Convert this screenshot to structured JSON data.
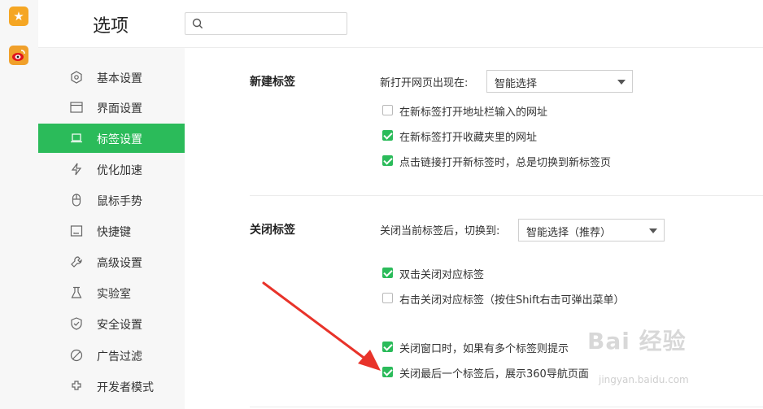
{
  "header": {
    "title": "选项",
    "search_placeholder": ""
  },
  "sidebar": {
    "items": [
      {
        "label": "基本设置",
        "icon": "hexagon-icon"
      },
      {
        "label": "界面设置",
        "icon": "window-icon"
      },
      {
        "label": "标签设置",
        "icon": "tab-icon"
      },
      {
        "label": "优化加速",
        "icon": "lightning-icon"
      },
      {
        "label": "鼠标手势",
        "icon": "mouse-icon"
      },
      {
        "label": "快捷键",
        "icon": "keyboard-icon"
      },
      {
        "label": "高级设置",
        "icon": "wrench-icon"
      },
      {
        "label": "实验室",
        "icon": "flask-icon"
      },
      {
        "label": "安全设置",
        "icon": "shield-icon"
      },
      {
        "label": "广告过滤",
        "icon": "block-icon"
      },
      {
        "label": "开发者模式",
        "icon": "puzzle-icon"
      }
    ],
    "active_index": 2
  },
  "new_tab": {
    "title": "新建标签",
    "open_label": "新打开网页出现在:",
    "open_select": "智能选择",
    "options": [
      {
        "label": "在新标签打开地址栏输入的网址",
        "checked": false
      },
      {
        "label": "在新标签打开收藏夹里的网址",
        "checked": true
      },
      {
        "label": "点击链接打开新标签时，总是切换到新标签页",
        "checked": true
      }
    ]
  },
  "close_tab": {
    "title": "关闭标签",
    "switch_label": "关闭当前标签后，切换到:",
    "switch_select": "智能选择（推荐）",
    "options": [
      {
        "label": "双击关闭对应标签",
        "checked": true
      },
      {
        "label": "右击关闭对应标签（按住Shift右击可弹出菜单）",
        "checked": false
      },
      {
        "label": "关闭窗口时，如果有多个标签则提示",
        "checked": true
      },
      {
        "label": "关闭最后一个标签后，展示360导航页面",
        "checked": true
      }
    ]
  },
  "watermark": {
    "brand": "Bai 经验",
    "url": "jingyan.baidu.com"
  },
  "colors": {
    "accent": "#2bbb5a",
    "arrow": "#e8332a"
  }
}
